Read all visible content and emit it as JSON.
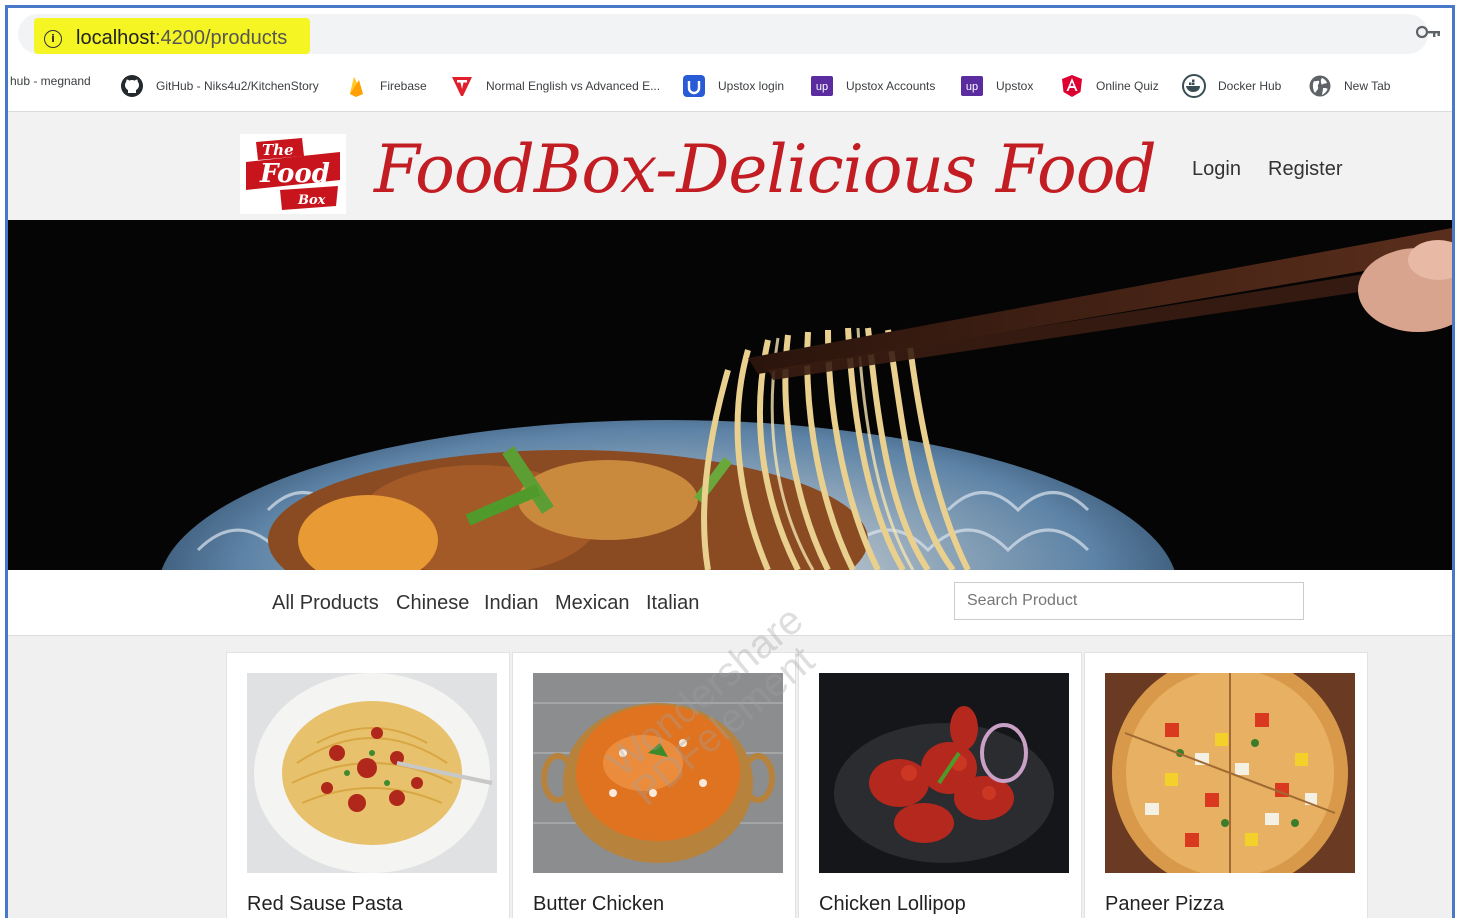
{
  "browser": {
    "url_host": "localhost",
    "url_path": ":4200/products",
    "bookmarks": [
      {
        "label": "hub - megnand",
        "icon": "none"
      },
      {
        "label": "GitHub - Niks4u2/KitchenStory",
        "icon": "github-icon"
      },
      {
        "label": "Firebase",
        "icon": "firebase-icon"
      },
      {
        "label": "Normal English vs Advanced E...",
        "icon": "t-logo-icon"
      },
      {
        "label": "Upstox login",
        "icon": "upstox-login-icon"
      },
      {
        "label": "Upstox Accounts",
        "icon": "upstox-icon"
      },
      {
        "label": "Upstox",
        "icon": "upstox-icon"
      },
      {
        "label": "Online Quiz",
        "icon": "angular-icon"
      },
      {
        "label": "Docker Hub",
        "icon": "docker-icon"
      },
      {
        "label": "New Tab",
        "icon": "globe-icon"
      }
    ]
  },
  "header": {
    "logo": {
      "line1": "The",
      "line2": "Food",
      "line3": "Box"
    },
    "brand": "FoodBox-Delicious Food",
    "nav": {
      "login": "Login",
      "register": "Register"
    }
  },
  "categories": [
    "All Products",
    "Chinese",
    "Indian",
    "Mexican",
    "Italian"
  ],
  "search": {
    "placeholder": "Search Product"
  },
  "products": [
    {
      "name": "Red Sause Pasta"
    },
    {
      "name": "Butter Chicken"
    },
    {
      "name": "Chicken Lollipop"
    },
    {
      "name": "Paneer Pizza"
    }
  ],
  "watermark": {
    "line1": "Wondershare",
    "line2": "PDFelement"
  },
  "colors": {
    "brand_red": "#c31d24",
    "frame_blue": "#4a78c8",
    "url_highlight": "#f5f524"
  }
}
